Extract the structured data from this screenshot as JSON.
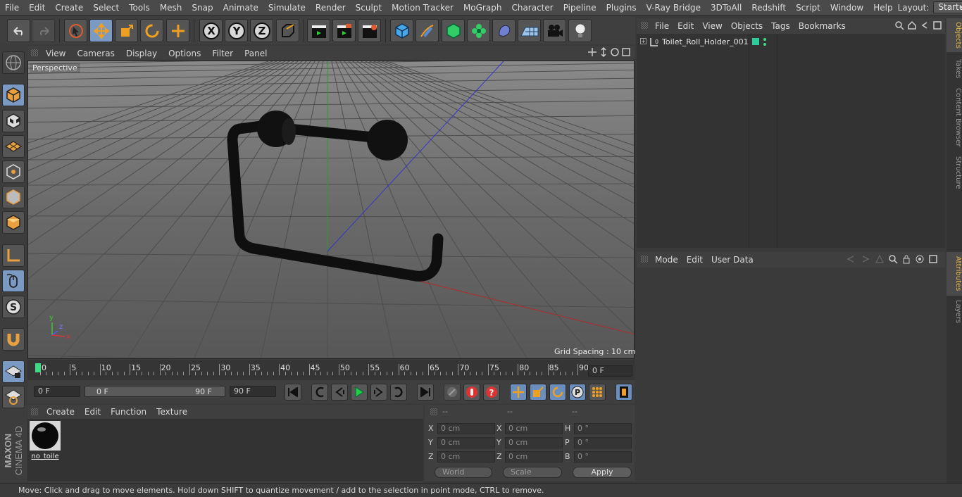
{
  "menubar": {
    "items": [
      "File",
      "Edit",
      "Create",
      "Select",
      "Tools",
      "Mesh",
      "Snap",
      "Animate",
      "Simulate",
      "Render",
      "Sculpt",
      "Motion Tracker",
      "MoGraph",
      "Character",
      "Pipeline",
      "Plugins",
      "V-Ray Bridge",
      "3DToAll",
      "Redshift",
      "Script",
      "Window",
      "Help"
    ],
    "layout_label": "Layout:",
    "layout_value": "Startup"
  },
  "viewport": {
    "menu": [
      "View",
      "Cameras",
      "Display",
      "Options",
      "Filter",
      "Panel"
    ],
    "camera_label": "Perspective",
    "grid_spacing": "Grid Spacing : 10 cm",
    "axis_y": "y",
    "axis_z": "z",
    "axis_x": "x"
  },
  "timeline": {
    "ticks": [
      "0",
      "5",
      "10",
      "15",
      "20",
      "25",
      "30",
      "35",
      "40",
      "45",
      "50",
      "55",
      "60",
      "65",
      "70",
      "75",
      "80",
      "85",
      "90"
    ],
    "current_frame": "0 F",
    "start_field": "0 F",
    "range_start": "0 F",
    "range_end": "90 F",
    "end_field": "90 F"
  },
  "material": {
    "menu": [
      "Create",
      "Edit",
      "Function",
      "Texture"
    ],
    "item_name": "no_toile"
  },
  "coords": {
    "headers": [
      "--",
      "--",
      "--"
    ],
    "rows": [
      {
        "l1": "X",
        "v1": "0 cm",
        "l2": "X",
        "v2": "0 cm",
        "l3": "H",
        "v3": "0 °"
      },
      {
        "l1": "Y",
        "v1": "0 cm",
        "l2": "Y",
        "v2": "0 cm",
        "l3": "P",
        "v3": "0 °"
      },
      {
        "l1": "Z",
        "v1": "0 cm",
        "l2": "Z",
        "v2": "0 cm",
        "l3": "B",
        "v3": "0 °"
      }
    ],
    "space": "World",
    "mode": "Scale",
    "apply": "Apply"
  },
  "objects": {
    "menu": [
      "File",
      "Edit",
      "View",
      "Objects",
      "Tags",
      "Bookmarks"
    ],
    "items": [
      {
        "name": "Toilet_Roll_Holder_001"
      }
    ]
  },
  "attributes": {
    "menu": [
      "Mode",
      "Edit",
      "User Data"
    ]
  },
  "sidetabs": [
    "Objects",
    "Takes",
    "Content Browser",
    "Structure",
    "Attributes",
    "Layers"
  ],
  "branding": {
    "maxon": "MAXON",
    "product": "CINEMA 4D"
  },
  "status": "Move: Click and drag to move elements. Hold down SHIFT to quantize movement / add to the selection in point mode, CTRL to remove.",
  "colors": {
    "accent": "#7a9ac4",
    "x_axis": "#c03030",
    "y_axis": "#30a030",
    "z_axis": "#3535c8",
    "active_tab": "#e8b94a",
    "obj_tag": "#2ecc9a"
  }
}
